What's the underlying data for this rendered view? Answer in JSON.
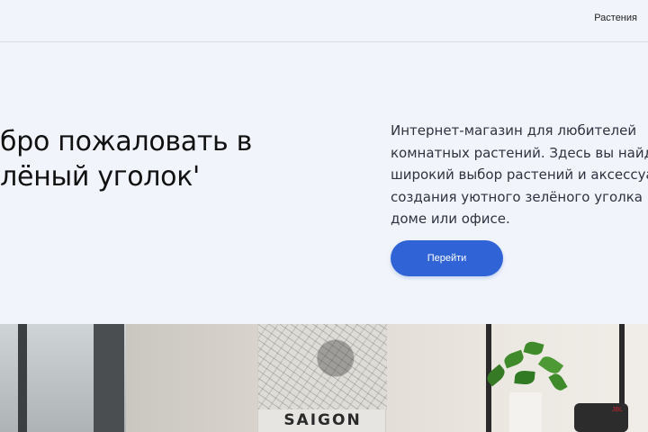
{
  "header": {
    "nav_link": "Растения"
  },
  "hero": {
    "title_line1": "обро пожаловать в",
    "title_line2": "елёный уголок'",
    "description_lines": [
      "Интернет-магазин для любителей",
      "комнатных растений. Здесь вы найдёте",
      "широкий выбор растений и аксессуаров д",
      "создания уютного зелёного уголка вваше",
      "доме или офисе."
    ],
    "cta_label": "Перейти"
  },
  "photo": {
    "poster_text": "SAIGON",
    "speaker_label": "JBL"
  },
  "colors": {
    "background": "#f1f4fb",
    "accent": "#2f63d6"
  }
}
